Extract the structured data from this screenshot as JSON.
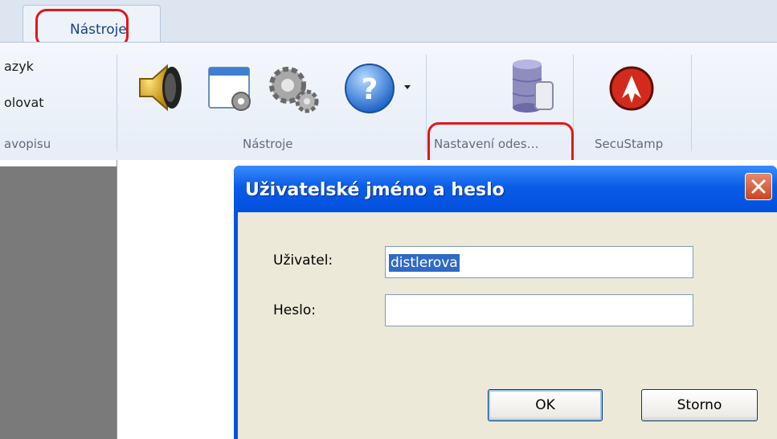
{
  "ribbon": {
    "active_tab": "Nástroje",
    "left_items": [
      "azyk",
      "olovat"
    ],
    "groups": [
      "avopisu",
      "Nástroje",
      "Nastavení odes…",
      "SecuStamp"
    ],
    "icons": [
      "speaker-icon",
      "window-settings-icon",
      "gears-icon",
      "help-icon",
      "database-scroll-icon",
      "secustamp-icon"
    ]
  },
  "dialog": {
    "title": "Uživatelské jméno a heslo",
    "user_label": "Uživatel:",
    "user_value": "distlerova",
    "password_label": "Heslo:",
    "password_value": "",
    "ok_label": "OK",
    "cancel_label": "Storno"
  },
  "colors": {
    "annotation": "#e01818",
    "title_bar": "#0a5ce6",
    "selection": "#316ac5",
    "dialog_face": "#ece9d8"
  }
}
